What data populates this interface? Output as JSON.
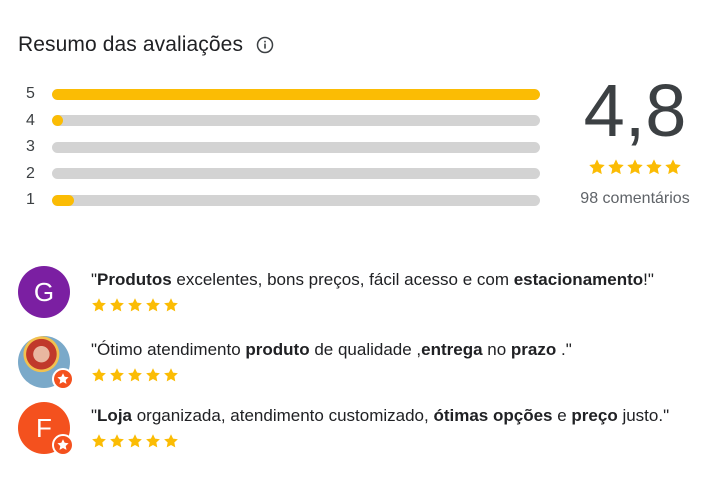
{
  "header": {
    "title": "Resumo das avaliações",
    "info_icon": "info-icon"
  },
  "distribution": [
    {
      "label": "5",
      "fraction": 1.0
    },
    {
      "label": "4",
      "fraction": 0.022
    },
    {
      "label": "3",
      "fraction": 0.0
    },
    {
      "label": "2",
      "fraction": 0.0
    },
    {
      "label": "1",
      "fraction": 0.045
    }
  ],
  "summary": {
    "score": "4,8",
    "stars": 5,
    "count_text": "98 comentários"
  },
  "reviews": [
    {
      "avatar_letter": "G",
      "avatar_color": "#7b1fa2",
      "badge": false,
      "stars": 5,
      "segments": [
        {
          "t": "\"",
          "b": false
        },
        {
          "t": "Produtos",
          "b": true
        },
        {
          "t": " excelentes, bons preços, fácil acesso e com ",
          "b": false
        },
        {
          "t": "estacionamento",
          "b": true
        },
        {
          "t": "!\"",
          "b": false
        }
      ]
    },
    {
      "avatar_letter": "",
      "avatar_color": "#7aa9c9",
      "badge": true,
      "stars": 5,
      "segments": [
        {
          "t": "\"Ótimo atendimento ",
          "b": false
        },
        {
          "t": "produto",
          "b": true
        },
        {
          "t": " de qualidade ,",
          "b": false
        },
        {
          "t": "entrega",
          "b": true
        },
        {
          "t": " no ",
          "b": false
        },
        {
          "t": "prazo",
          "b": true
        },
        {
          "t": " .\"",
          "b": false
        }
      ]
    },
    {
      "avatar_letter": "F",
      "avatar_color": "#f4511e",
      "badge": true,
      "stars": 5,
      "segments": [
        {
          "t": "\"",
          "b": false
        },
        {
          "t": "Loja",
          "b": true
        },
        {
          "t": " organizada, atendimento customizado, ",
          "b": false
        },
        {
          "t": "ótimas opções",
          "b": true
        },
        {
          "t": " e ",
          "b": false
        },
        {
          "t": "preço",
          "b": true
        },
        {
          "t": " justo.\"",
          "b": false
        }
      ]
    }
  ],
  "colors": {
    "star": "#fbbc04",
    "track": "#d3d3d3",
    "badge": "#f4511e"
  }
}
